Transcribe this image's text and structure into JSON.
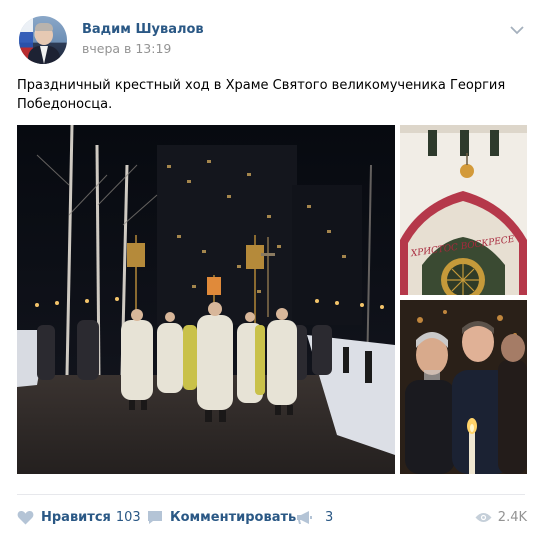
{
  "post": {
    "author": "Вадим Шувалов",
    "time": "вчера в 13:19",
    "text": "Праздничный крестный ход в Храме Святого великомученика Георгия Победоносца.",
    "church_sign": "ХРИСТОС ВОСКРЕСЕ"
  },
  "actions": {
    "like_label": "Нравится",
    "like_count": "103",
    "comment_label": "Комментировать",
    "share_count": "3",
    "views_count": "2.4K"
  },
  "icons": {
    "menu": "chevron-down-icon",
    "like": "heart-icon",
    "comment": "comment-icon",
    "share": "megaphone-icon",
    "views": "eye-icon"
  },
  "colors": {
    "link": "#2a5885",
    "muted": "#939393",
    "icon": "#b4c4d6"
  }
}
